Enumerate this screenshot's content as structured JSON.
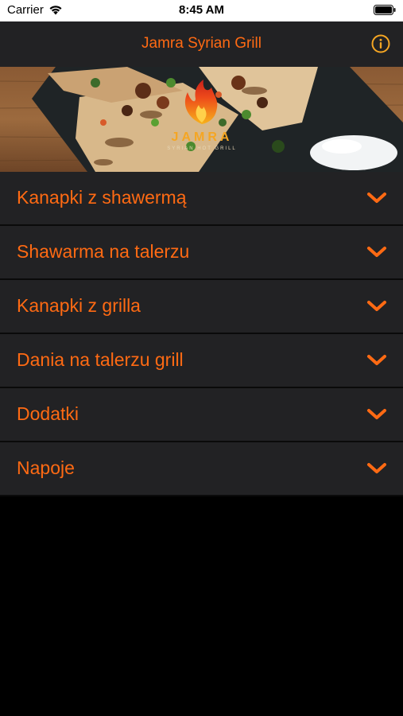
{
  "status_bar": {
    "carrier": "Carrier",
    "time": "8:45 AM"
  },
  "header": {
    "title": "Jamra Syrian Grill",
    "info_icon": "info-circle-icon"
  },
  "hero": {
    "logo_name": "JAMRA",
    "logo_tagline": "SYRIAN HOT GRILL"
  },
  "menu": {
    "items": [
      {
        "label": "Kanapki z shawermą"
      },
      {
        "label": "Shawarma na talerzu"
      },
      {
        "label": "Kanapki z grilla"
      },
      {
        "label": "Dania na talerzu grill"
      },
      {
        "label": "Dodatki"
      },
      {
        "label": "Napoje"
      }
    ]
  },
  "colors": {
    "accent": "#ff6a13",
    "cell_background": "#222224",
    "page_background": "#000000",
    "info_icon": "#f5a623"
  }
}
